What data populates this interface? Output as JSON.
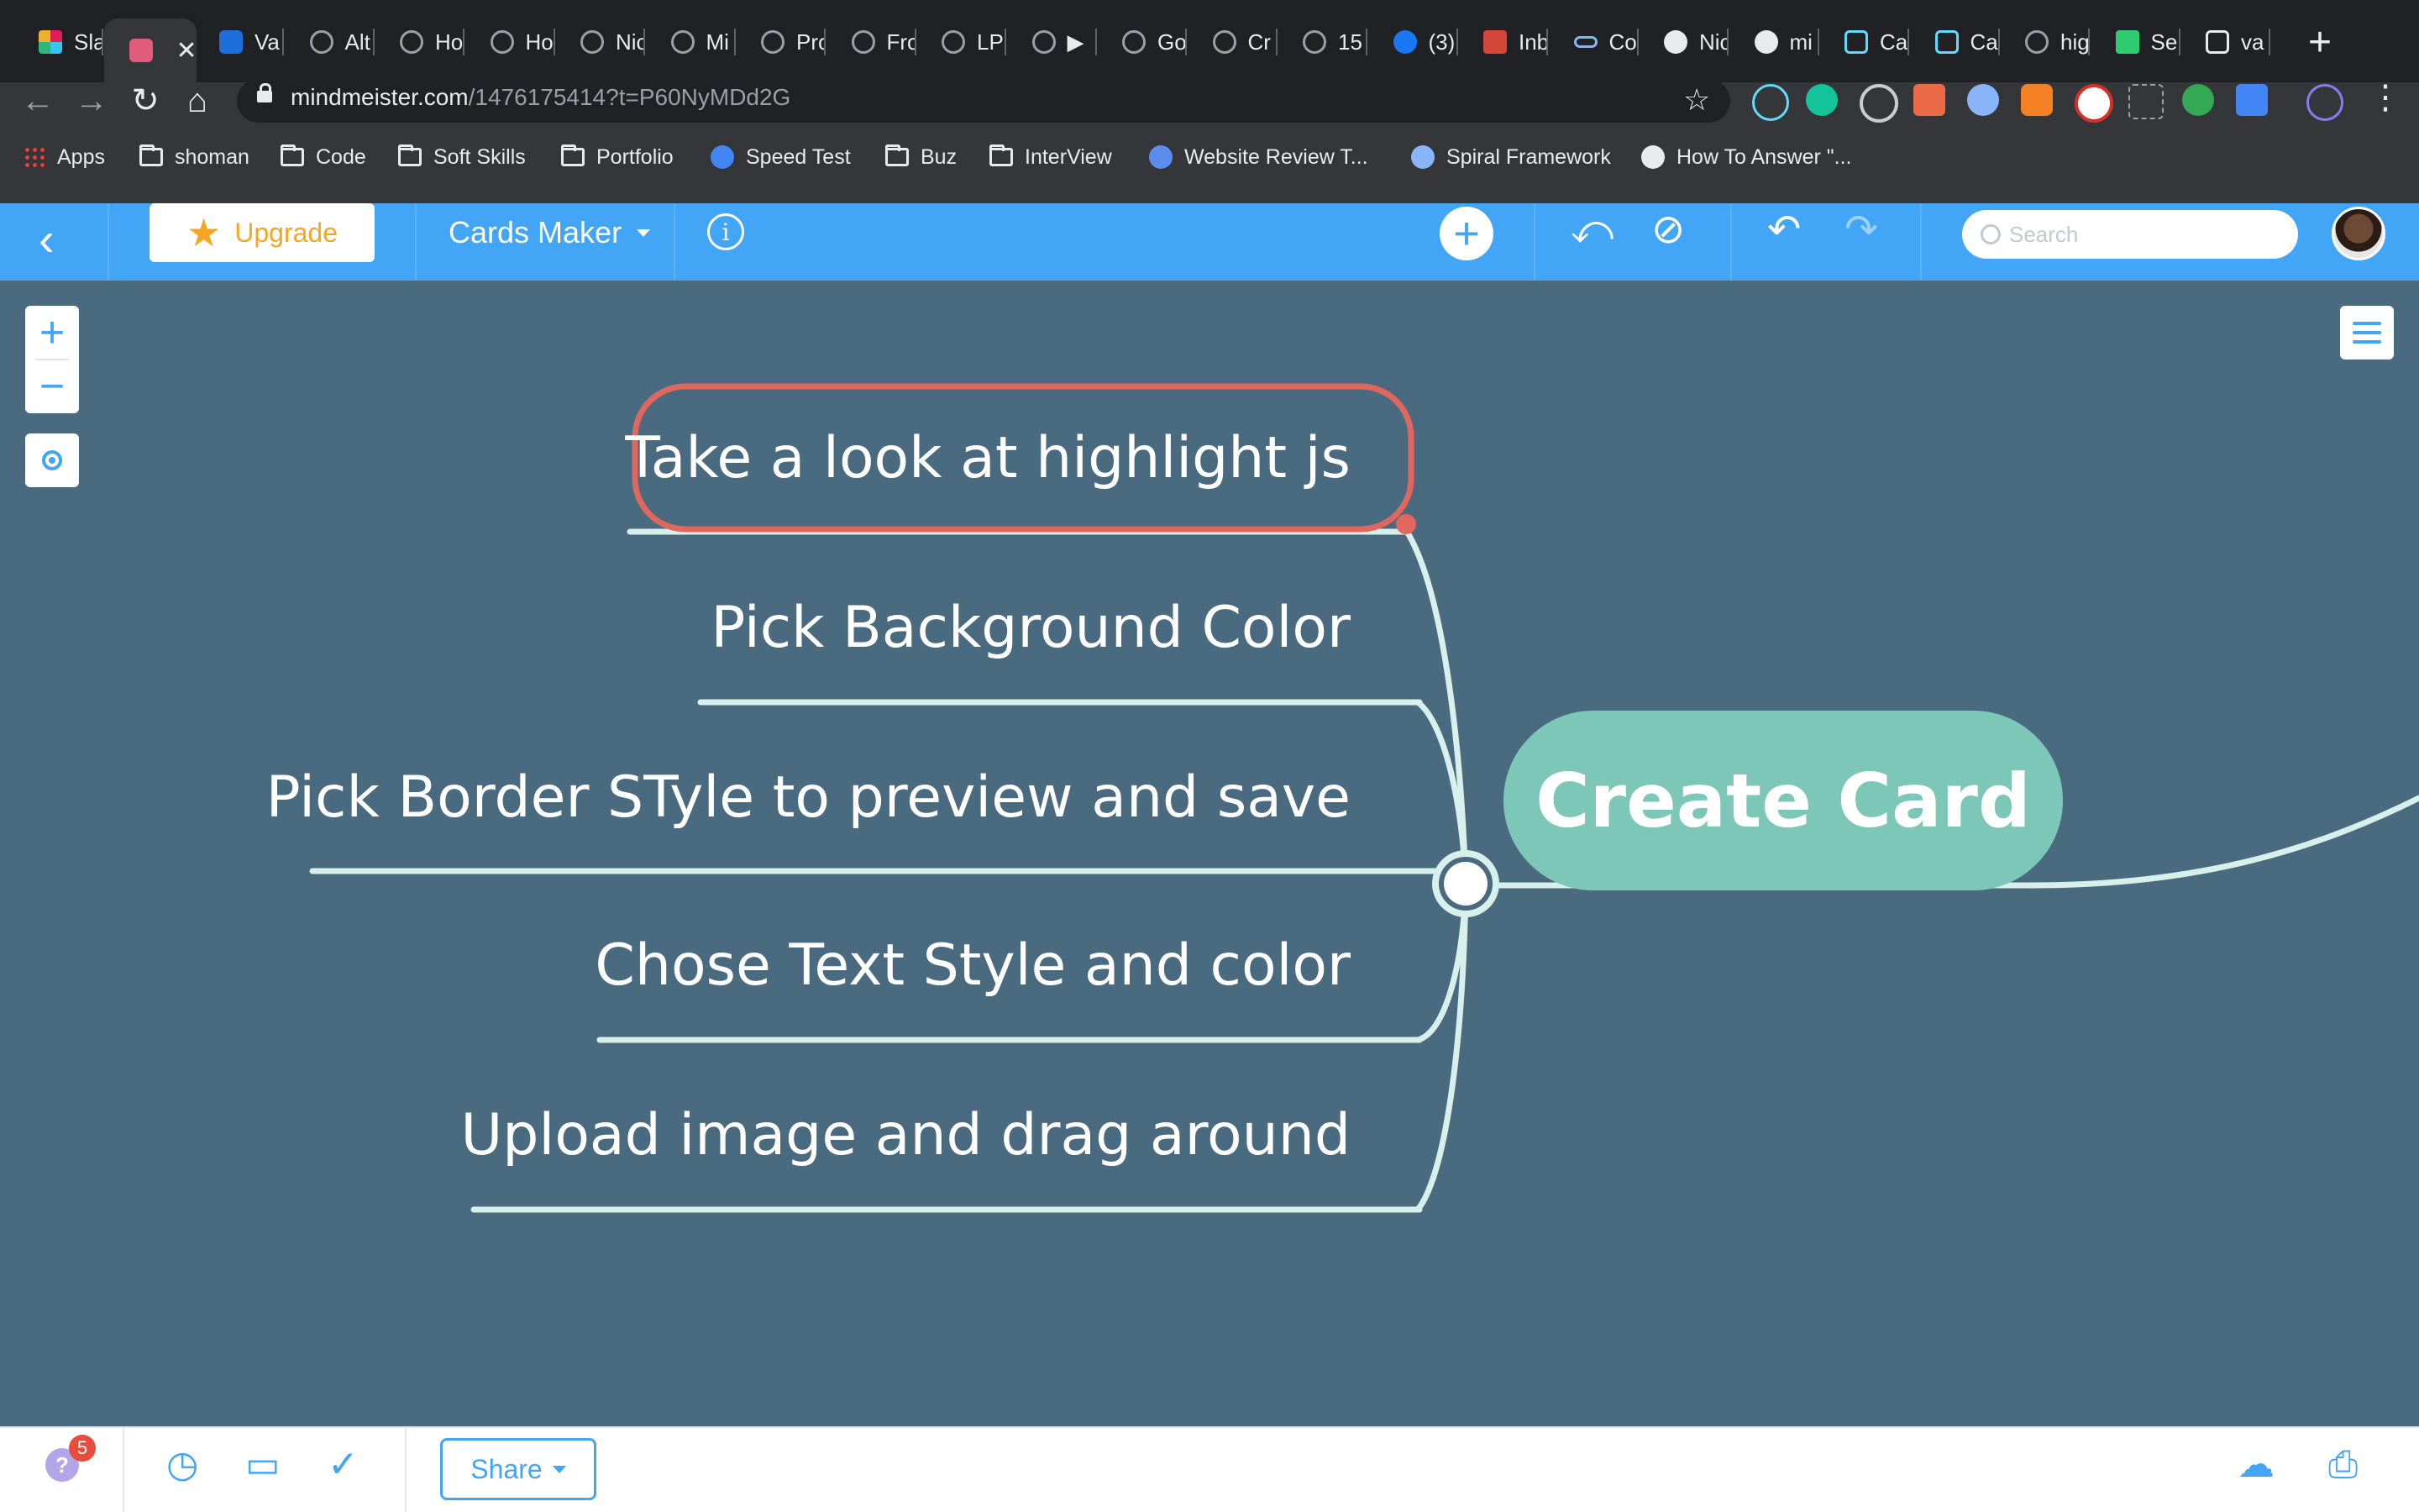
{
  "browser": {
    "tabs": [
      {
        "label": "Sla",
        "icon": "slack-icon"
      },
      {
        "label": "",
        "icon": "app-icon",
        "active": true
      },
      {
        "label": "Va",
        "icon": "webflow-icon"
      },
      {
        "label": "Alt",
        "icon": "globe-icon"
      },
      {
        "label": "Ho",
        "icon": "globe-icon"
      },
      {
        "label": "Ho",
        "icon": "globe-icon"
      },
      {
        "label": "Nic",
        "icon": "globe-icon"
      },
      {
        "label": "Mi",
        "icon": "globe-icon"
      },
      {
        "label": "Pro",
        "icon": "globe-icon"
      },
      {
        "label": "Fro",
        "icon": "globe-icon"
      },
      {
        "label": "LP",
        "icon": "globe-icon"
      },
      {
        "label": "▶",
        "icon": "globe-icon"
      },
      {
        "label": "Go",
        "icon": "globe-icon"
      },
      {
        "label": "Cr",
        "icon": "globe-icon"
      },
      {
        "label": "15",
        "icon": "globe-icon"
      },
      {
        "label": "(3)",
        "icon": "facebook-icon"
      },
      {
        "label": "Inb",
        "icon": "mail-icon"
      },
      {
        "label": "Co",
        "icon": "infinity-icon"
      },
      {
        "label": "Nic",
        "icon": "github-icon"
      },
      {
        "label": "mi",
        "icon": "github-icon"
      },
      {
        "label": "Ca",
        "icon": "react-icon"
      },
      {
        "label": "Ca",
        "icon": "react-icon"
      },
      {
        "label": "hig",
        "icon": "globe-icon"
      },
      {
        "label": "Se",
        "icon": "leaf-icon"
      },
      {
        "label": "va",
        "icon": "codepen-icon"
      }
    ],
    "new_tab": "+",
    "tab_close": "✕",
    "url_host": "mindmeister.com",
    "url_path": "/1476175414?t=P60NyMDd2G",
    "bookmarks": [
      {
        "label": "Apps",
        "icon": "apps-grid-icon"
      },
      {
        "label": "shoman",
        "icon": "folder-icon"
      },
      {
        "label": "Code",
        "icon": "folder-icon"
      },
      {
        "label": "Soft Skills",
        "icon": "folder-icon"
      },
      {
        "label": "Portfolio",
        "icon": "folder-icon"
      },
      {
        "label": "Speed Test",
        "icon": "speedtest-icon"
      },
      {
        "label": "Buz",
        "icon": "folder-icon"
      },
      {
        "label": "InterView",
        "icon": "folder-icon"
      },
      {
        "label": "Website Review T...",
        "icon": "check-badge-icon"
      },
      {
        "label": "Spiral Framework",
        "icon": "spiral-icon"
      },
      {
        "label": "How To Answer \"...",
        "icon": "bookmark-logo-icon"
      }
    ]
  },
  "app": {
    "upgrade_label": "Upgrade",
    "map_name": "Cards Maker",
    "search_placeholder": "Search",
    "accent_color": "#42a5f5",
    "canvas_color": "#4a6a80"
  },
  "mindmap": {
    "root": "Create Card",
    "root_color": "#7dc7b9",
    "selected_border_color": "#e0675e",
    "children": [
      {
        "text": "Take a look at highlight js",
        "selected": true
      },
      {
        "text": "Pick Background Color"
      },
      {
        "text": "Pick Border STyle to preview and save"
      },
      {
        "text": "Chose Text Style and color"
      },
      {
        "text": "Upload image and drag around"
      }
    ]
  },
  "footer": {
    "help_badge_count": "5",
    "share_label": "Share"
  }
}
